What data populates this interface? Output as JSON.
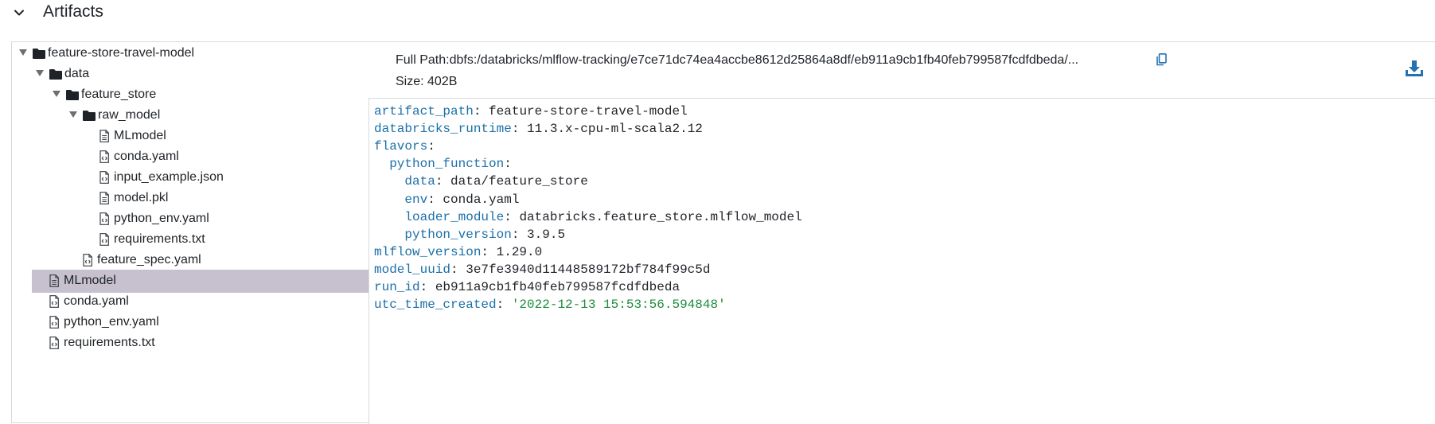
{
  "section": {
    "title": "Artifacts"
  },
  "tree": [
    {
      "label": "feature-store-travel-model",
      "type": "folder",
      "depth": 0,
      "expanded": true
    },
    {
      "label": "data",
      "type": "folder",
      "depth": 1,
      "expanded": true
    },
    {
      "label": "feature_store",
      "type": "folder",
      "depth": 2,
      "expanded": true
    },
    {
      "label": "raw_model",
      "type": "folder",
      "depth": 3,
      "expanded": true
    },
    {
      "label": "MLmodel",
      "type": "file-text",
      "depth": 4
    },
    {
      "label": "conda.yaml",
      "type": "file-code",
      "depth": 4
    },
    {
      "label": "input_example.json",
      "type": "file-code",
      "depth": 4
    },
    {
      "label": "model.pkl",
      "type": "file-text",
      "depth": 4
    },
    {
      "label": "python_env.yaml",
      "type": "file-code",
      "depth": 4
    },
    {
      "label": "requirements.txt",
      "type": "file-code",
      "depth": 4
    },
    {
      "label": "feature_spec.yaml",
      "type": "file-code",
      "depth": 3
    },
    {
      "label": "MLmodel",
      "type": "file-text",
      "depth": 1,
      "selected": true
    },
    {
      "label": "conda.yaml",
      "type": "file-code",
      "depth": 1
    },
    {
      "label": "python_env.yaml",
      "type": "file-code",
      "depth": 1
    },
    {
      "label": "requirements.txt",
      "type": "file-code",
      "depth": 1
    }
  ],
  "viewer": {
    "full_path": "Full Path:dbfs:/databricks/mlflow-tracking/e7ce71dc74ea4accbe8612d25864a8df/eb911a9cb1fb40feb799587fcdfdbeda/...",
    "size": "Size: 402B",
    "lines": [
      {
        "indent": "",
        "key": "artifact_path",
        "value": "feature-store-travel-model",
        "value_type": "plain"
      },
      {
        "indent": "",
        "key": "databricks_runtime",
        "value": "11.3.x-cpu-ml-scala2.12",
        "value_type": "plain"
      },
      {
        "indent": "",
        "key": "flavors",
        "value": "",
        "value_type": "plain"
      },
      {
        "indent": "  ",
        "key": "python_function",
        "value": "",
        "value_type": "plain"
      },
      {
        "indent": "    ",
        "key": "data",
        "value": "data/feature_store",
        "value_type": "plain"
      },
      {
        "indent": "    ",
        "key": "env",
        "value": "conda.yaml",
        "value_type": "plain"
      },
      {
        "indent": "    ",
        "key": "loader_module",
        "value": "databricks.feature_store.mlflow_model",
        "value_type": "plain"
      },
      {
        "indent": "    ",
        "key": "python_version",
        "value": "3.9.5",
        "value_type": "plain"
      },
      {
        "indent": "",
        "key": "mlflow_version",
        "value": "1.29.0",
        "value_type": "plain"
      },
      {
        "indent": "",
        "key": "model_uuid",
        "value": "3e7fe3940d11448589172bf784f99c5d",
        "value_type": "plain"
      },
      {
        "indent": "",
        "key": "run_id",
        "value": "eb911a9cb1fb40feb799587fcdfdbeda",
        "value_type": "plain"
      },
      {
        "indent": "",
        "key": "utc_time_created",
        "value": "'2022-12-13 15:53:56.594848'",
        "value_type": "string"
      }
    ]
  },
  "icons": {
    "collapse": "chevron-down-icon",
    "folder": "folder-icon",
    "file_text": "file-text-icon",
    "file_code": "file-code-icon",
    "copy": "copy-icon",
    "download": "download-icon"
  },
  "colors": {
    "selected_row": "#c7c0cf",
    "yaml_key": "#1b6fa8",
    "yaml_string": "#1e8c3a",
    "accent": "#2272b4"
  }
}
